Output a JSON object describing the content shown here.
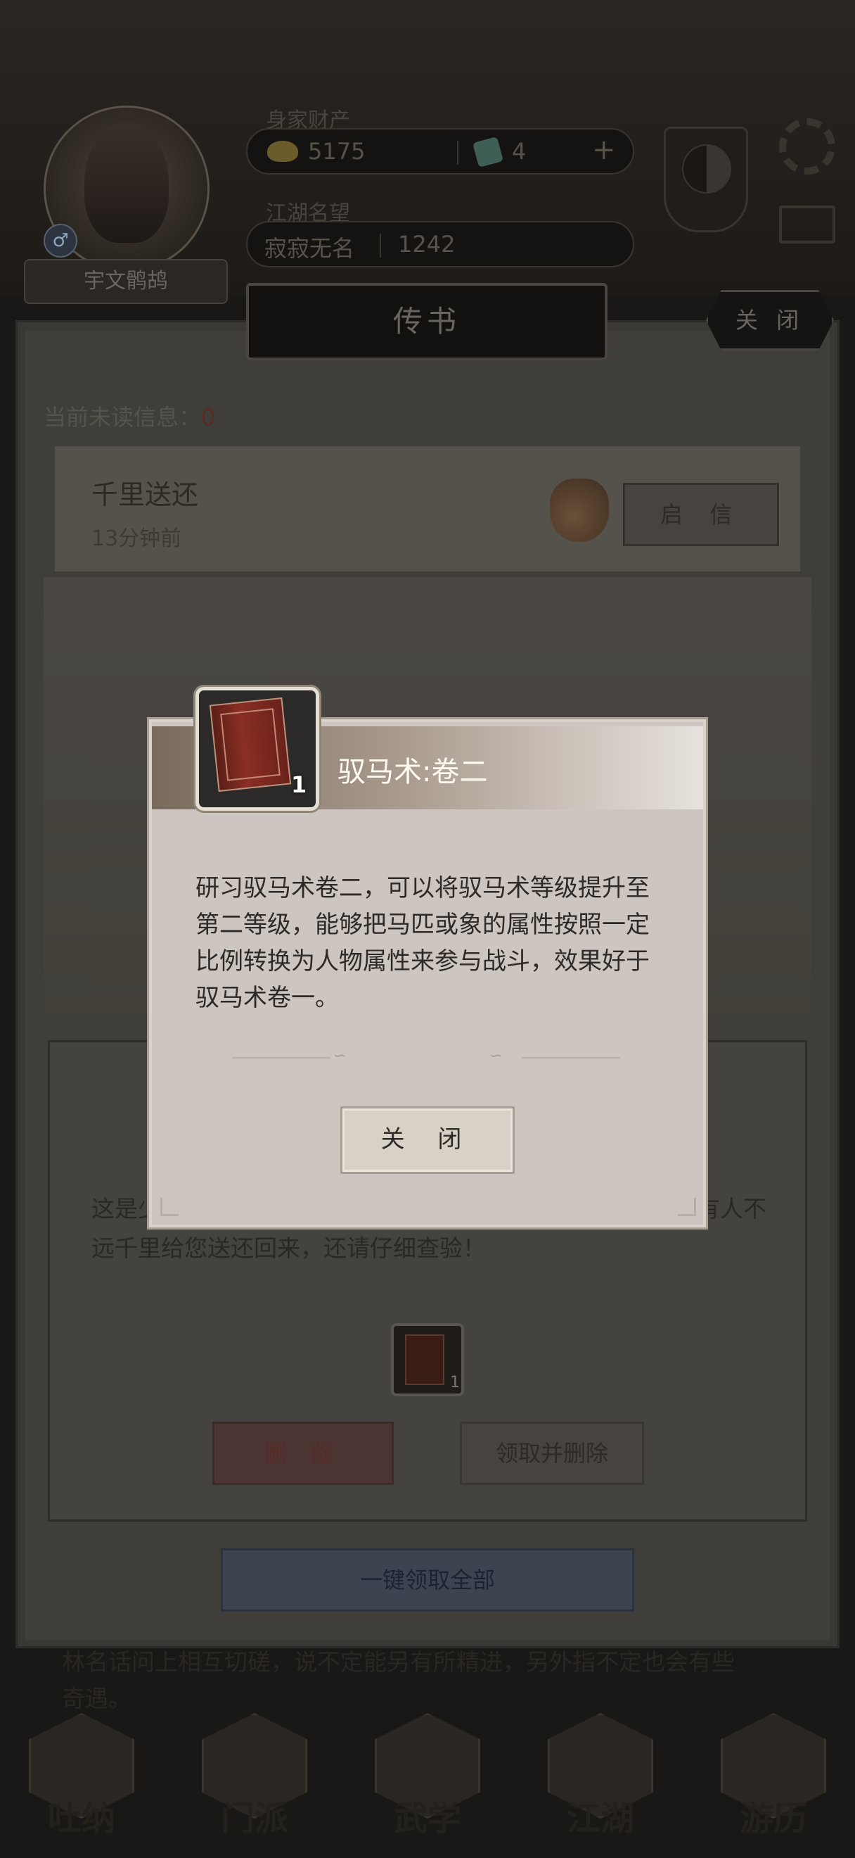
{
  "profile": {
    "name": "宇文鹘鸪",
    "gender_icon": "male-symbol-icon"
  },
  "resources": {
    "wealth_label": "身家财产",
    "gold": "5175",
    "jade": "4",
    "plus": "+",
    "reputation_label": "江湖名望",
    "reputation_title": "寂寂无名",
    "reputation_value": "1242"
  },
  "panel": {
    "title": "传书",
    "close_label": "关 闭",
    "unread_label": "当前未读信息：",
    "unread_count": "0",
    "letter": {
      "title": "千里送还",
      "time": "13分钟前",
      "open_label": "启 信"
    },
    "detail": {
      "body_line1": "这是少",
      "body_line1_tail": "有人不",
      "body_line2": "远千里给您送还回来，还请仔细查验！",
      "item_count": "1",
      "delete_label": "删 除",
      "take_delete_label": "领取并删除"
    },
    "claim_all_label": "一键领取全部",
    "bottom_line1": "林名话问上相互切磋，说不定能另有所精进，另外指不定也会有些",
    "bottom_line2": "奇遇。"
  },
  "nav": [
    {
      "label": "吐纳",
      "icon": "breath-icon"
    },
    {
      "label": "门派",
      "icon": "sect-flag-icon"
    },
    {
      "label": "武学",
      "icon": "martial-book-icon"
    },
    {
      "label": "江湖",
      "icon": "jianghu-hat-icon"
    },
    {
      "label": "游历",
      "icon": "horse-travel-icon"
    }
  ],
  "dialog": {
    "title": "驭马术:卷二",
    "item_count": "1",
    "description": "研习驭马术卷二，可以将驭马术等级提升至第二等级，能够把马匹或象的属性按照一定比例转换为人物属性来参与战斗，效果好于驭马术卷一。",
    "close_label": "关 闭"
  },
  "colors": {
    "dialog_bg": "#cdc5bf",
    "dialog_header_dark": "#7a6a5c",
    "title_text": "#fffaf2",
    "unread_count": "#8a2a24"
  }
}
